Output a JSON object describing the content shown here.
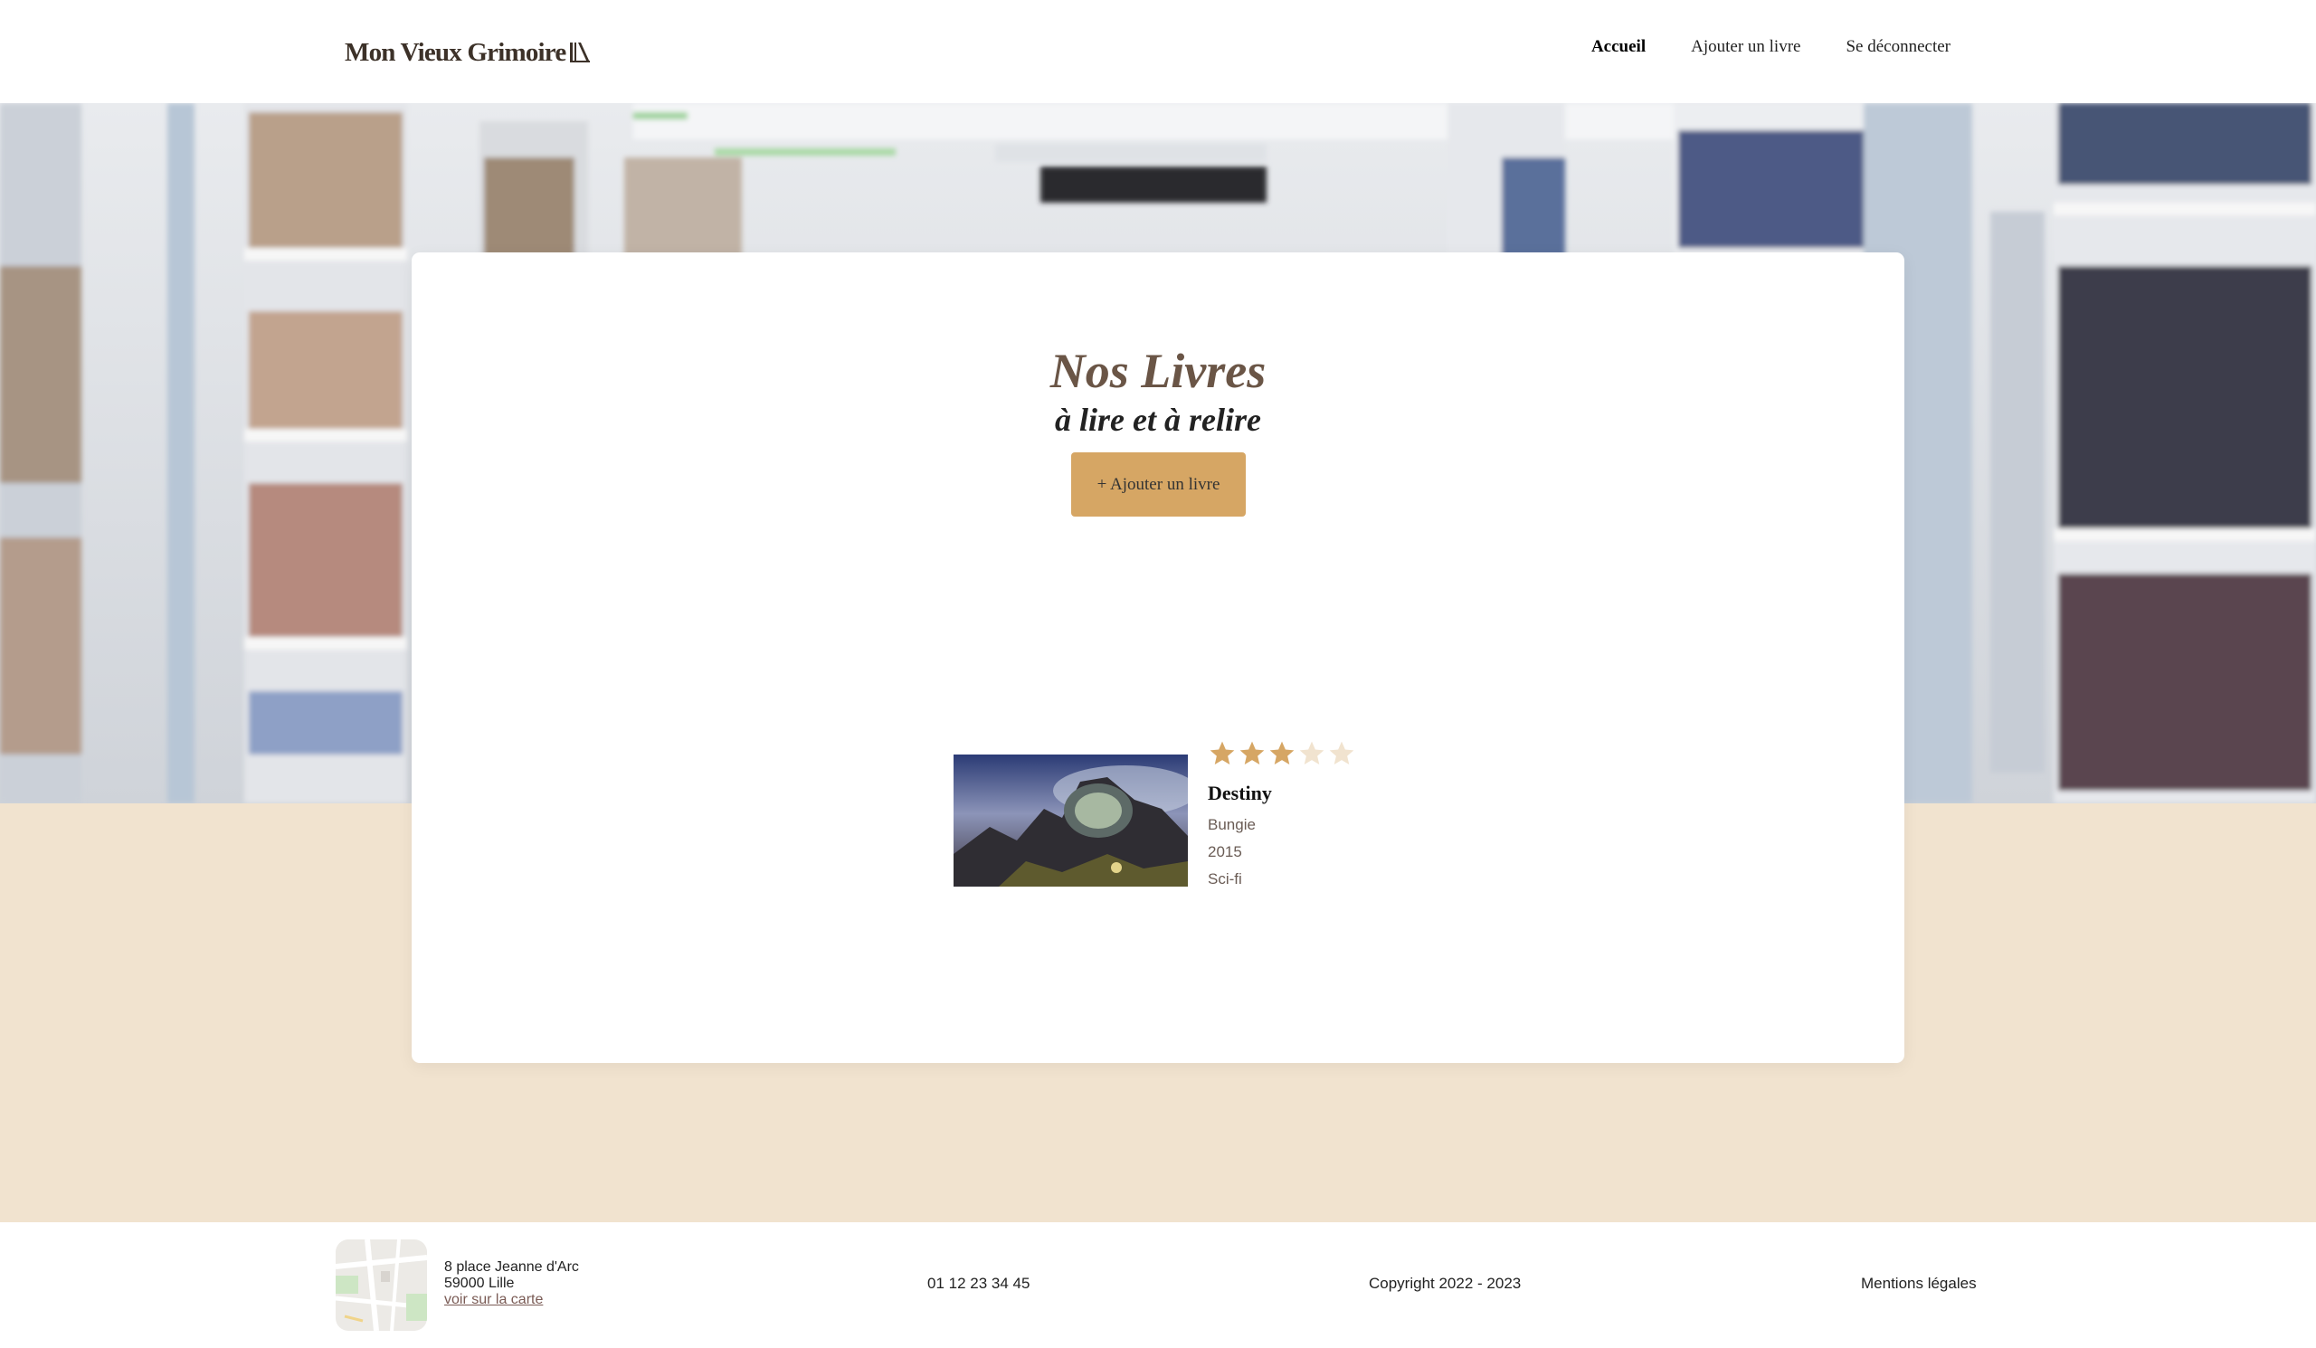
{
  "header": {
    "logo_text": "Mon Vieux Grimoire",
    "nav": [
      {
        "label": "Accueil",
        "active": true
      },
      {
        "label": "Ajouter un livre",
        "active": false
      },
      {
        "label": "Se déconnecter",
        "active": false
      }
    ]
  },
  "main": {
    "title": "Nos Livres",
    "subtitle": "à lire et à relire",
    "add_button": "+ Ajouter un livre",
    "books": [
      {
        "title": "Destiny",
        "author": "Bungie",
        "year": "2015",
        "genre": "Sci-fi",
        "rating": 3,
        "max_rating": 5
      }
    ]
  },
  "footer": {
    "address_line1": "8 place Jeanne d'Arc",
    "address_line2": "59000 Lille",
    "map_link": "voir sur la carte",
    "phone": "01 12 23 34 45",
    "copyright": "Copyright 2022 - 2023",
    "legal": "Mentions légales"
  },
  "colors": {
    "accent": "#d6a664",
    "beige_background": "#f1e3cf",
    "title_brown": "#6a5546",
    "star_filled": "#d6a664",
    "star_empty": "#f1e3cf"
  }
}
